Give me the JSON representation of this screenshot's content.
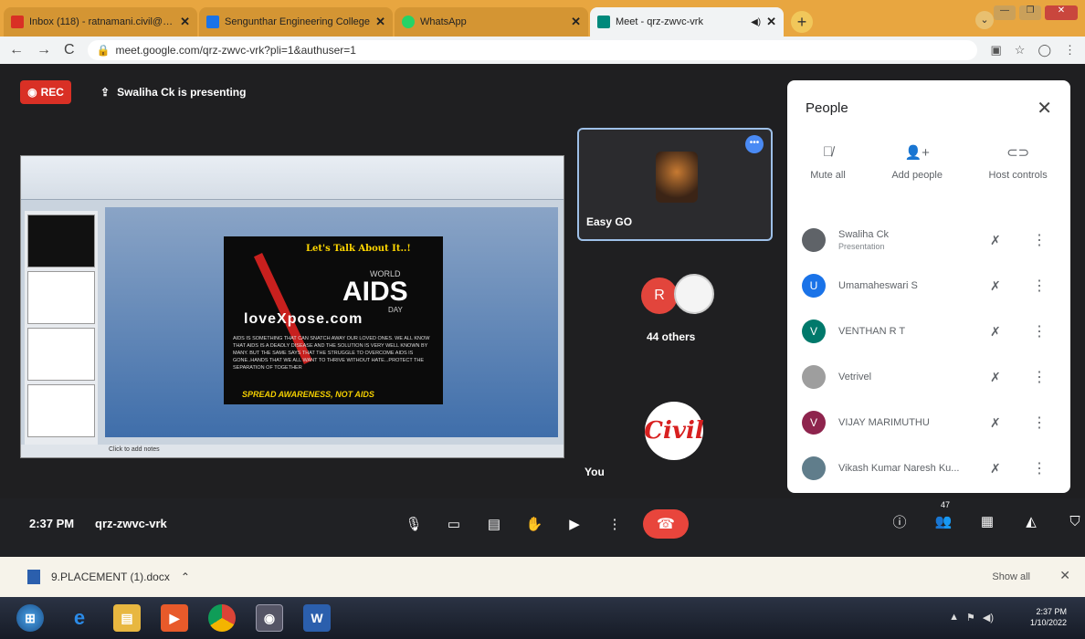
{
  "browser": {
    "tabs": [
      {
        "title": "Inbox (118) - ratnamani.civil@s...",
        "color": "#d93025",
        "active": false
      },
      {
        "title": "Sengunthar Engineering College",
        "color": "#1a73e8",
        "active": false
      },
      {
        "title": "WhatsApp",
        "color": "#25d366",
        "active": false
      },
      {
        "title": "Meet - qrz-zwvc-vrk",
        "color": "#00897b",
        "active": true
      }
    ],
    "url": "meet.google.com/qrz-zwvc-vrk?pli=1&authuser=1"
  },
  "meet": {
    "rec_label": "REC",
    "presenting_text": "Swaliha Ck is presenting",
    "slide": {
      "heading": "Let's Talk About It..!",
      "world": "WORLD",
      "aids": "AIDS",
      "day": "DAY",
      "brand": "loveXpose.com",
      "body": "AIDS IS SOMETHING THAT CAN SNATCH AWAY OUR LOVED ONES. WE ALL KNOW THAT AIDS IS A DEADLY DISEASE AND THE SOLUTION IS VERY WELL KNOWN BY MANY. BUT THE SAME SAYS THAT THE STRUGGLE TO OVERCOME AIDS IS GONE..HANDS THAT WE ALL WANT TO THRIVE WITHOUT HATE...PROTECT THE SEPARATION OF TOGETHER",
      "footer": "SPREAD AWARENESS, NOT AIDS",
      "notes": "Click to add notes"
    },
    "tile_name": "Easy GO",
    "others": "44 others",
    "you_label": "You",
    "civil_logo": "Civil",
    "time": "2:37 PM",
    "meeting_code": "qrz-zwvc-vrk",
    "participant_count": "47"
  },
  "people_panel": {
    "title": "People",
    "actions": [
      {
        "label": "Mute all",
        "icon": "mic-off-icon"
      },
      {
        "label": "Add people",
        "icon": "person-add-icon"
      },
      {
        "label": "Host controls",
        "icon": "toggle-icon"
      }
    ],
    "participants": [
      {
        "name": "Swaliha Ck",
        "sub": "Presentation",
        "initial": "",
        "color": "#5f6368"
      },
      {
        "name": "Umamaheswari S",
        "sub": "",
        "initial": "U",
        "color": "#1a73e8"
      },
      {
        "name": "VENTHAN R T",
        "sub": "",
        "initial": "V",
        "color": "#00796b"
      },
      {
        "name": "Vetrivel",
        "sub": "",
        "initial": "",
        "color": "#9e9e9e"
      },
      {
        "name": "VIJAY MARIMUTHU",
        "sub": "",
        "initial": "V",
        "color": "#8e244d"
      },
      {
        "name": "Vikash Kumar Naresh Ku...",
        "sub": "",
        "initial": "",
        "color": "#607d8b"
      }
    ]
  },
  "downloads": {
    "file": "9.PLACEMENT (1).docx",
    "show_all": "Show all"
  },
  "taskbar": {
    "time": "2:37 PM",
    "date": "1/10/2022"
  }
}
